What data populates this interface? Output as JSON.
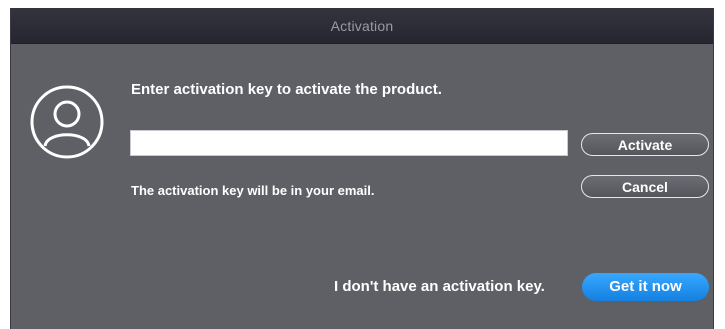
{
  "window": {
    "title": "Activation"
  },
  "account_icon": "user-avatar-icon",
  "activation": {
    "prompt": "Enter activation key to activate the product.",
    "key_value": "",
    "hint": "The activation key will be in your email.",
    "activate_label": "Activate",
    "cancel_label": "Cancel"
  },
  "footer": {
    "no_key_text": "I don't have an activation key.",
    "get_it_now_label": "Get it now"
  },
  "colors": {
    "dialog_background": "#5f5f66",
    "titlebar": "#2c2c36",
    "accent": "#1e90f0"
  }
}
